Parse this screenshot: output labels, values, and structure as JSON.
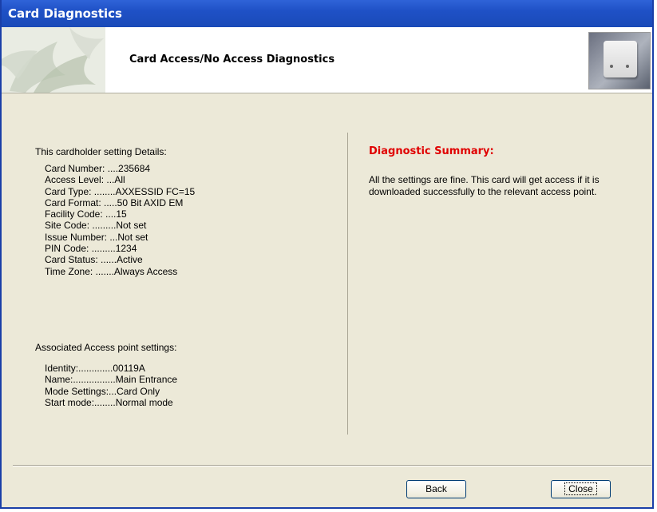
{
  "window": {
    "title": "Card Diagnostics"
  },
  "banner": {
    "title": "Card Access/No Access Diagnostics"
  },
  "cardholder": {
    "heading": "This cardholder setting Details:",
    "rows": [
      "Card Number: ....235684",
      "Access Level: ...All",
      "Card Type: ........AXXESSID FC=15",
      "Card Format: .....50 Bit AXID EM",
      "Facility Code: ....15",
      "Site Code: .........Not set",
      "Issue Number: ...Not set",
      "PIN Code: .........1234",
      "Card Status: ......Active",
      "Time Zone: .......Always Access"
    ]
  },
  "access_point": {
    "heading": "Associated Access point settings:",
    "rows": [
      "Identity:.............00119A",
      "Name:................Main Entrance",
      "Mode Settings:...Card Only",
      "Start mode:........Normal mode"
    ]
  },
  "summary": {
    "title": "Diagnostic Summary:",
    "text": "All the settings are fine. This card will get access if it is downloaded successfully to the relevant access point."
  },
  "buttons": {
    "back": "Back",
    "close": "Close"
  }
}
